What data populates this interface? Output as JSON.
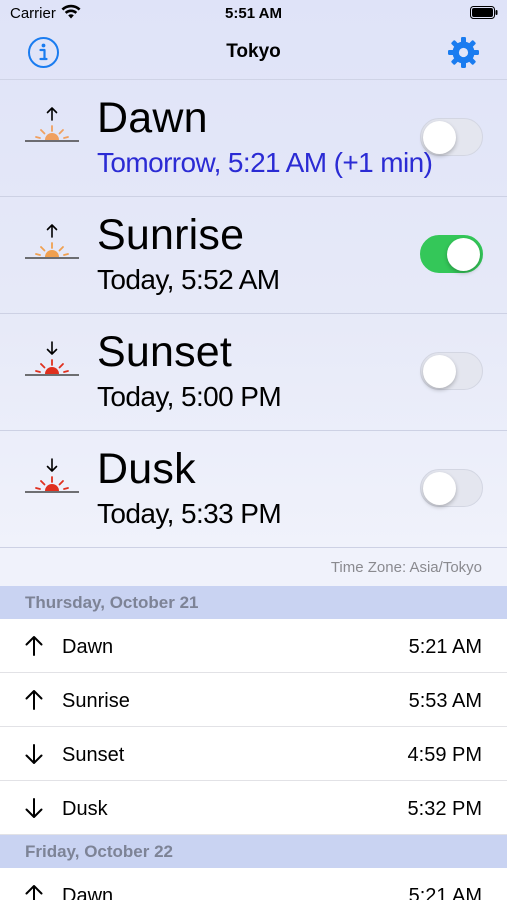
{
  "status_bar": {
    "carrier": "Carrier",
    "time": "5:51 AM"
  },
  "nav": {
    "title": "Tokyo"
  },
  "events": [
    {
      "name": "Dawn",
      "time": "Tomorrow, 5:21 AM (+1 min)",
      "enabled": false,
      "direction": "up",
      "sun_color": "#f0a060"
    },
    {
      "name": "Sunrise",
      "time": "Today, 5:52 AM",
      "enabled": true,
      "direction": "up",
      "sun_color": "#f0a050"
    },
    {
      "name": "Sunset",
      "time": "Today, 5:00 PM",
      "enabled": false,
      "direction": "down",
      "sun_color": "#e0301e"
    },
    {
      "name": "Dusk",
      "time": "Today, 5:33 PM",
      "enabled": false,
      "direction": "down",
      "sun_color": "#e0301e"
    }
  ],
  "time_zone_label": "Time Zone: Asia/Tokyo",
  "days": [
    {
      "header": "Thursday, October 21",
      "rows": [
        {
          "direction": "up",
          "name": "Dawn",
          "time": "5:21 AM"
        },
        {
          "direction": "up",
          "name": "Sunrise",
          "time": "5:53 AM"
        },
        {
          "direction": "down",
          "name": "Sunset",
          "time": "4:59 PM"
        },
        {
          "direction": "down",
          "name": "Dusk",
          "time": "5:32 PM"
        }
      ]
    },
    {
      "header": "Friday, October 22",
      "rows": [
        {
          "direction": "up",
          "name": "Dawn",
          "time": "5:21 AM"
        }
      ]
    }
  ],
  "colors": {
    "accent": "#1a7cf0",
    "toggle_on": "#34c759",
    "dawn_time": "#2b2bd4"
  }
}
